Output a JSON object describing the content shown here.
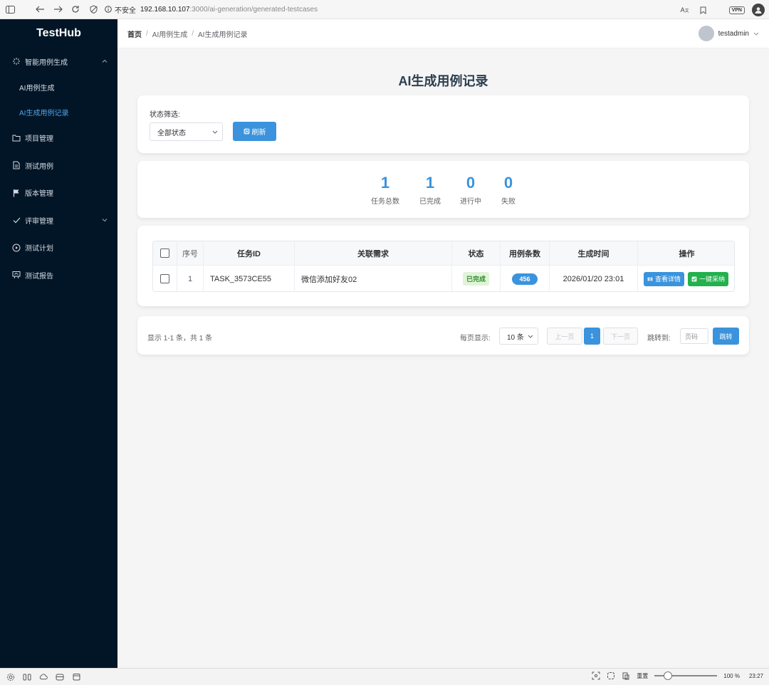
{
  "browser": {
    "insecure_label": "不安全",
    "url_host": "192.168.10.107",
    "url_path": ":3000/ai-generation/generated-testcases",
    "vpn_label": "VPN"
  },
  "sidebar": {
    "logo": "TestHub",
    "menu": {
      "ai_gen": "智能用例生成",
      "ai_case_gen": "AI用例生成",
      "ai_case_records": "AI生成用例记录",
      "project": "项目管理",
      "testcase": "测试用例",
      "version": "版本管理",
      "review": "评审管理",
      "plan": "测试计划",
      "report": "测试报告"
    }
  },
  "header": {
    "breadcrumb": [
      "首页",
      "AI用例生成",
      "AI生成用例记录"
    ],
    "username": "testadmin"
  },
  "page": {
    "title": "AI生成用例记录"
  },
  "filter": {
    "label": "状态筛选:",
    "status_selected": "全部状态",
    "refresh_label": "刷新"
  },
  "stats": [
    {
      "value": "1",
      "label": "任务总数"
    },
    {
      "value": "1",
      "label": "已完成"
    },
    {
      "value": "0",
      "label": "进行中"
    },
    {
      "value": "0",
      "label": "失败"
    }
  ],
  "table": {
    "headers": [
      "序号",
      "任务ID",
      "关联需求",
      "状态",
      "用例条数",
      "生成时间",
      "操作"
    ],
    "rows": [
      {
        "seq": "1",
        "task_id": "TASK_3573CE55",
        "requirement": "微信添加好友02",
        "status": "已完成",
        "count": "456",
        "time": "2026/01/20 23:01",
        "view_label": "查看详情",
        "adopt_label": "一键采纳"
      }
    ]
  },
  "pagination": {
    "summary": "显示 1-1 条，共 1 条",
    "per_page_label": "每页显示:",
    "per_page_value": "10 条",
    "prev_label": "上一页",
    "current_page": "1",
    "next_label": "下一页",
    "jump_label": "跳转到:",
    "jump_placeholder": "页码",
    "jump_button": "跳转"
  },
  "statusbar": {
    "reset_label": "重置",
    "zoom": "100 %",
    "time": "23:27"
  },
  "colors": {
    "sidebar_bg": "#021526",
    "primary": "#3a93dc",
    "success": "#22b14c",
    "active_menu": "#4ea3ee"
  }
}
